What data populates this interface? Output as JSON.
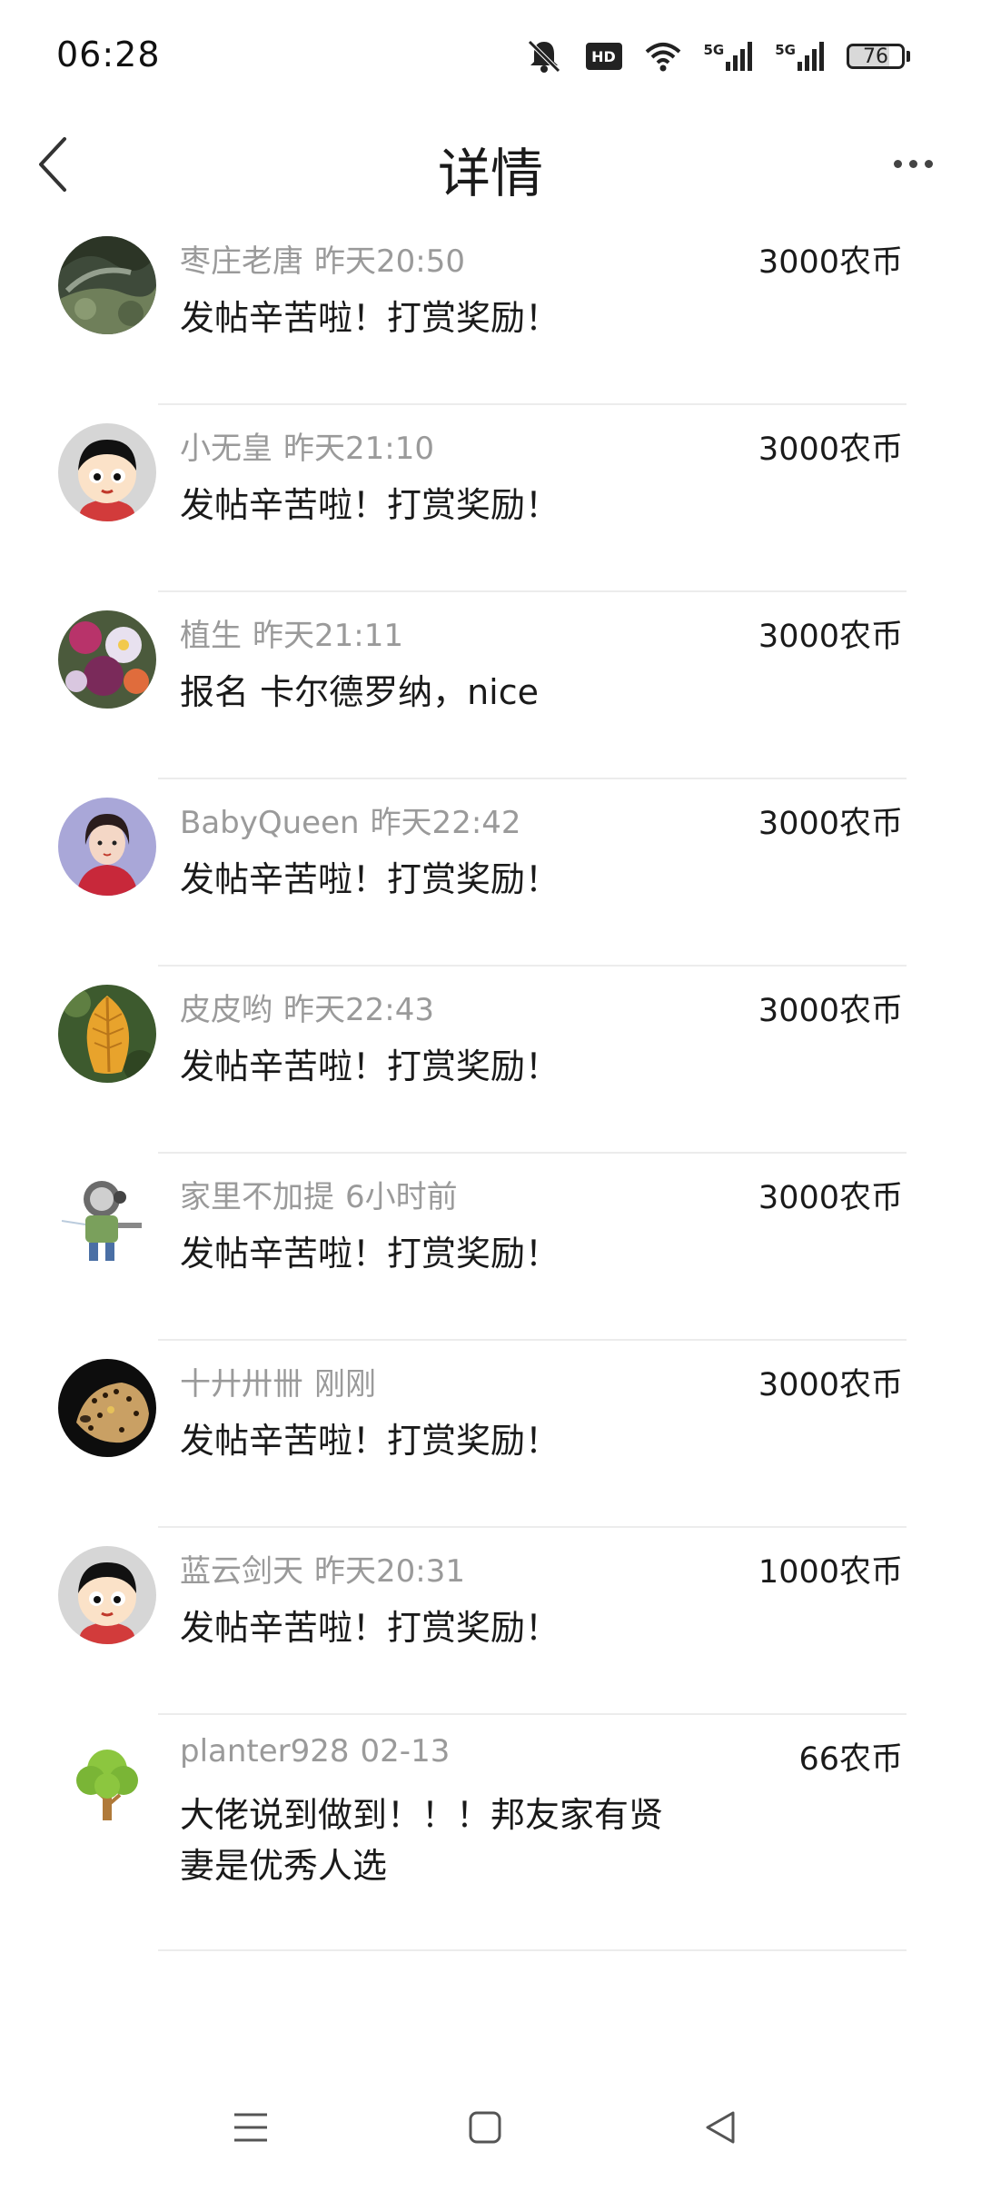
{
  "status_bar": {
    "time": "06:28",
    "network_label_1": "5G",
    "network_label_2": "5G",
    "hd_label": "HD",
    "battery": "76"
  },
  "header": {
    "title": "详情"
  },
  "rewards": [
    {
      "user": "枣庄老唐",
      "time": "昨天20:50",
      "amount": "3000农币",
      "message": "发帖辛苦啦！打赏奖励！",
      "avatar": "landscape"
    },
    {
      "user": "小无皇",
      "time": "昨天21:10",
      "amount": "3000农币",
      "message": "发帖辛苦啦！打赏奖励！",
      "avatar": "cartoon-kid"
    },
    {
      "user": "植生",
      "time": "昨天21:11",
      "amount": "3000农币",
      "message": "报名 卡尔德罗纳，nice",
      "avatar": "flowers"
    },
    {
      "user": "BabyQueen",
      "time": "昨天22:42",
      "amount": "3000农币",
      "message": "发帖辛苦啦！打赏奖励！",
      "avatar": "portrait"
    },
    {
      "user": "皮皮哟",
      "time": "昨天22:43",
      "amount": "3000农币",
      "message": "发帖辛苦啦！打赏奖励！",
      "avatar": "leaf"
    },
    {
      "user": "家里不加提",
      "time": "6小时前",
      "amount": "3000农币",
      "message": "发帖辛苦啦！打赏奖励！",
      "avatar": "robot"
    },
    {
      "user": "十廾卅卌",
      "time": "刚刚",
      "amount": "3000农币",
      "message": "发帖辛苦啦！打赏奖励！",
      "avatar": "leopard"
    },
    {
      "user": "蓝云剑天",
      "time": "昨天20:31",
      "amount": "1000农币",
      "message": "发帖辛苦啦！打赏奖励！",
      "avatar": "cartoon-kid"
    },
    {
      "user": "planter928",
      "time": "02-13",
      "amount": "66农币",
      "message": "大佬说到做到！！！邦友家有贤妻是优秀人选",
      "avatar": "tree"
    }
  ],
  "icons": {
    "back": "chevron-left-icon",
    "more": "more-dots-icon",
    "nav_menu": "menu-icon",
    "nav_home": "home-square-icon",
    "nav_back": "triangle-back-icon"
  }
}
